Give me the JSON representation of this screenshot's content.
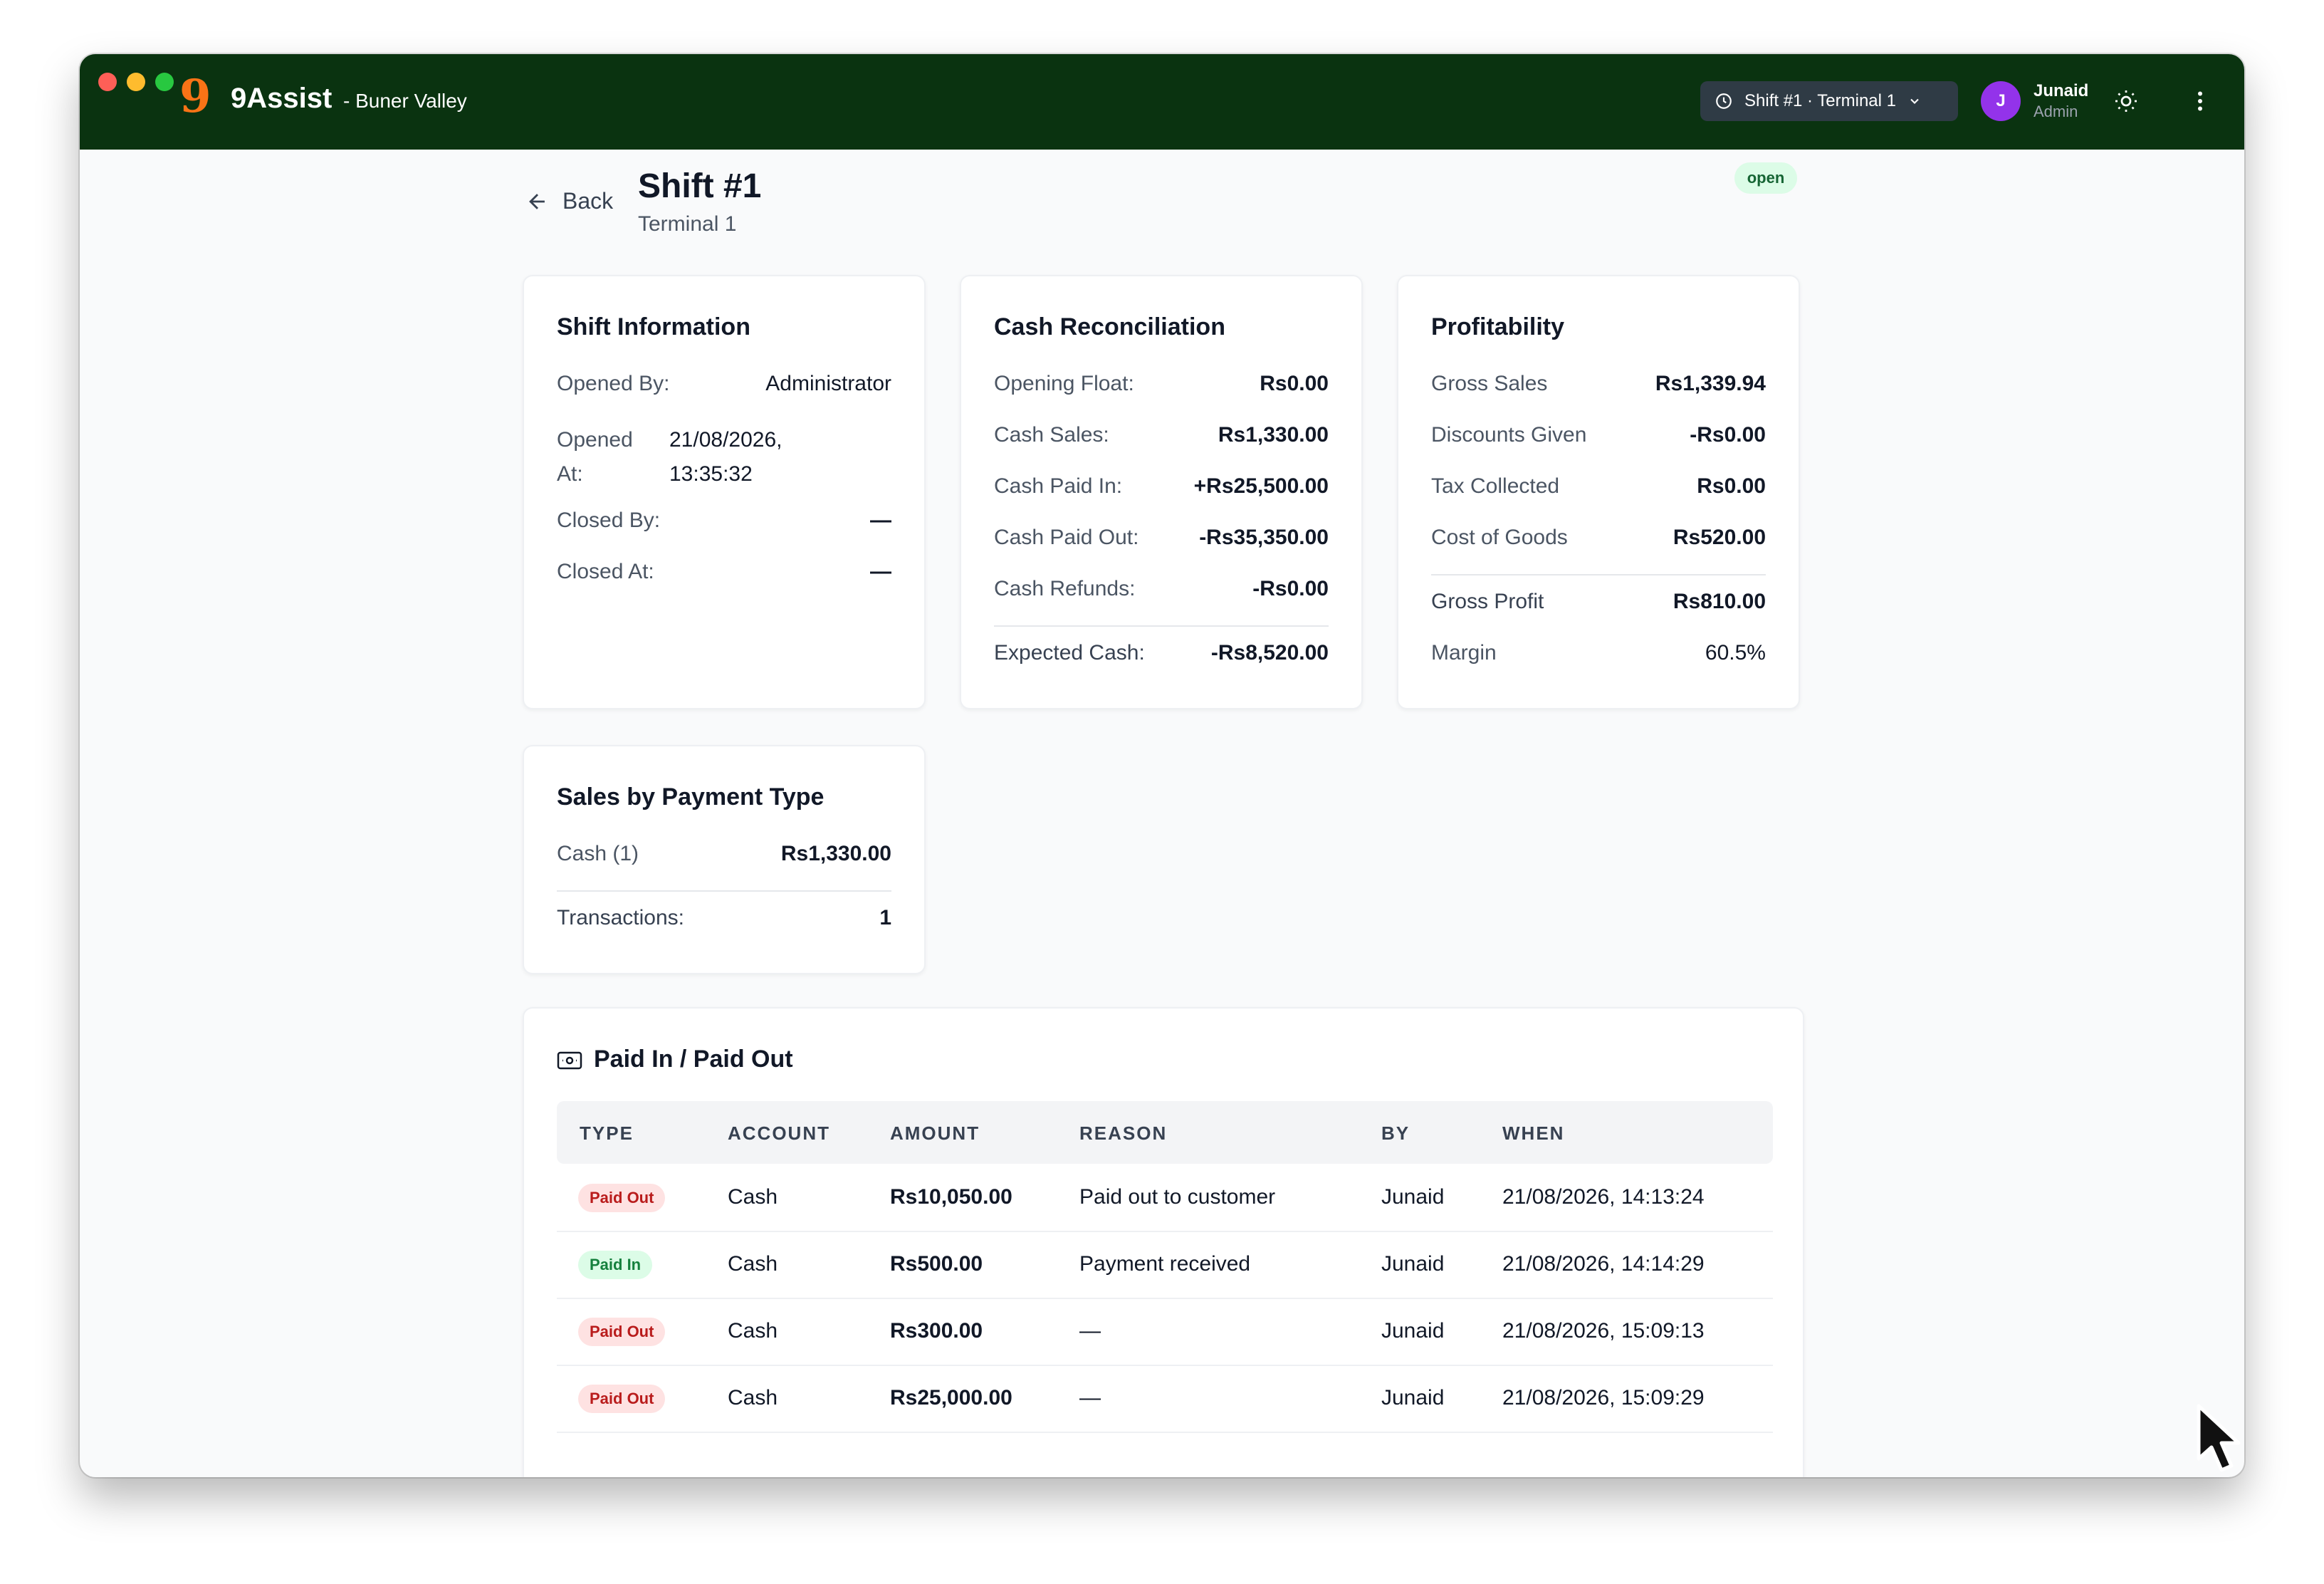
{
  "app": {
    "brand": "9Assist",
    "branch": "- Buner Valley",
    "logo_glyph": "9"
  },
  "header": {
    "shift_selector": "Shift #1 · Terminal 1",
    "user": {
      "initial": "J",
      "name": "Junaid",
      "role": "Admin"
    }
  },
  "page": {
    "back_label": "Back",
    "title": "Shift #1",
    "subtitle": "Terminal 1",
    "status": "open"
  },
  "shift_info": {
    "title": "Shift Information",
    "opened_by_label": "Opened By:",
    "opened_by": "Administrator",
    "opened_at_label_1": "Opened",
    "opened_at_label_2": "At:",
    "opened_at_date": "21/08/2026,",
    "opened_at_time": "13:35:32",
    "closed_by_label": "Closed By:",
    "closed_by": "—",
    "closed_at_label": "Closed At:",
    "closed_at": "—"
  },
  "cash_recon": {
    "title": "Cash Reconciliation",
    "rows": [
      {
        "label": "Opening Float:",
        "value": "Rs0.00"
      },
      {
        "label": "Cash Sales:",
        "value": "Rs1,330.00"
      },
      {
        "label": "Cash Paid In:",
        "value": "+Rs25,500.00"
      },
      {
        "label": "Cash Paid Out:",
        "value": "-Rs35,350.00"
      },
      {
        "label": "Cash Refunds:",
        "value": "-Rs0.00"
      }
    ],
    "expected_label": "Expected Cash:",
    "expected_value": "-Rs8,520.00"
  },
  "profitability": {
    "title": "Profitability",
    "rows": [
      {
        "label": "Gross Sales",
        "value": "Rs1,339.94"
      },
      {
        "label": "Discounts Given",
        "value": "-Rs0.00"
      },
      {
        "label": "Tax Collected",
        "value": "Rs0.00"
      },
      {
        "label": "Cost of Goods",
        "value": "Rs520.00"
      }
    ],
    "gross_profit_label": "Gross Profit",
    "gross_profit": "Rs810.00",
    "margin_label": "Margin",
    "margin": "60.5%"
  },
  "sales_by_payment": {
    "title": "Sales by Payment Type",
    "cash_label": "Cash (1)",
    "cash_value": "Rs1,330.00",
    "transactions_label": "Transactions:",
    "transactions": "1"
  },
  "paid_table": {
    "title": "Paid In / Paid Out",
    "columns": [
      "TYPE",
      "ACCOUNT",
      "AMOUNT",
      "REASON",
      "BY",
      "WHEN"
    ],
    "rows": [
      {
        "type": "Paid Out",
        "account": "Cash",
        "amount": "Rs10,050.00",
        "reason": "Paid out to customer",
        "by": "Junaid",
        "when": "21/08/2026, 14:13:24"
      },
      {
        "type": "Paid In",
        "account": "Cash",
        "amount": "Rs500.00",
        "reason": "Payment received",
        "by": "Junaid",
        "when": "21/08/2026, 14:14:29"
      },
      {
        "type": "Paid Out",
        "account": "Cash",
        "amount": "Rs300.00",
        "reason": "—",
        "by": "Junaid",
        "when": "21/08/2026, 15:09:13"
      },
      {
        "type": "Paid Out",
        "account": "Cash",
        "amount": "Rs25,000.00",
        "reason": "—",
        "by": "Junaid",
        "when": "21/08/2026, 15:09:29"
      }
    ]
  },
  "colors": {
    "titlebar": "#0a3310",
    "avatar": "#9333ea",
    "accent": "#f97316"
  }
}
